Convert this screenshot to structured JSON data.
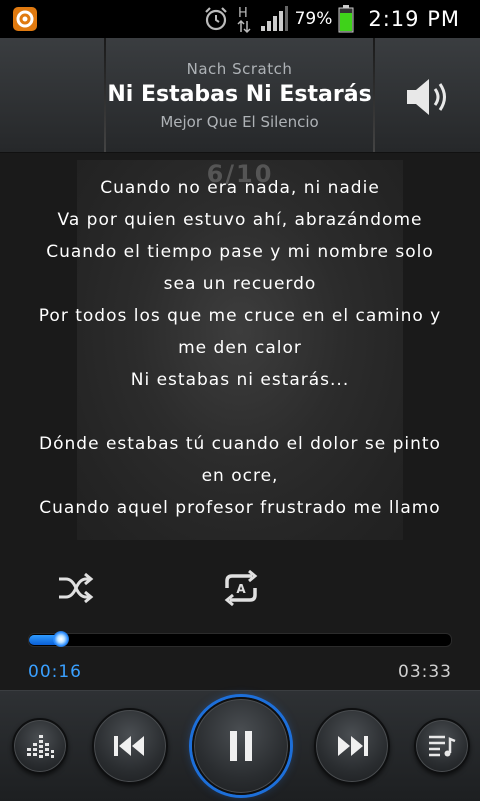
{
  "status_bar": {
    "battery_percent": "79%",
    "time": "2:19 PM",
    "network_label": "H"
  },
  "now_playing": {
    "artist": "Nach Scratch",
    "title": "Ni Estabas Ni Estarás",
    "album": "Mejor Que El Silencio",
    "track_indicator": "6/10"
  },
  "lyrics": [
    "Cuando no era nada, ni nadie",
    "Va por quien estuvo ahí, abrazándome",
    "Cuando el tiempo pase y mi nombre solo",
    "sea un recuerdo",
    "Por todos los que me cruce en el camino y",
    "me den calor",
    "Ni estabas ni estarás...",
    "",
    "Dónde estabas tú cuando el dolor se pinto",
    "en ocre,",
    "Cuando aquel profesor frustrado me llamo"
  ],
  "playback": {
    "elapsed": "00:16",
    "total": "03:33",
    "progress": 0.075
  },
  "colors": {
    "accent": "#2f9bff",
    "background": "#1a1a1a"
  },
  "icons": {
    "shuffle": "shuffle-icon",
    "repeat": "repeat-icon",
    "volume": "volume-icon",
    "equalizer": "equalizer-icon",
    "previous": "previous-icon",
    "pause": "pause-icon",
    "next": "next-icon",
    "playlist": "playlist-icon"
  }
}
